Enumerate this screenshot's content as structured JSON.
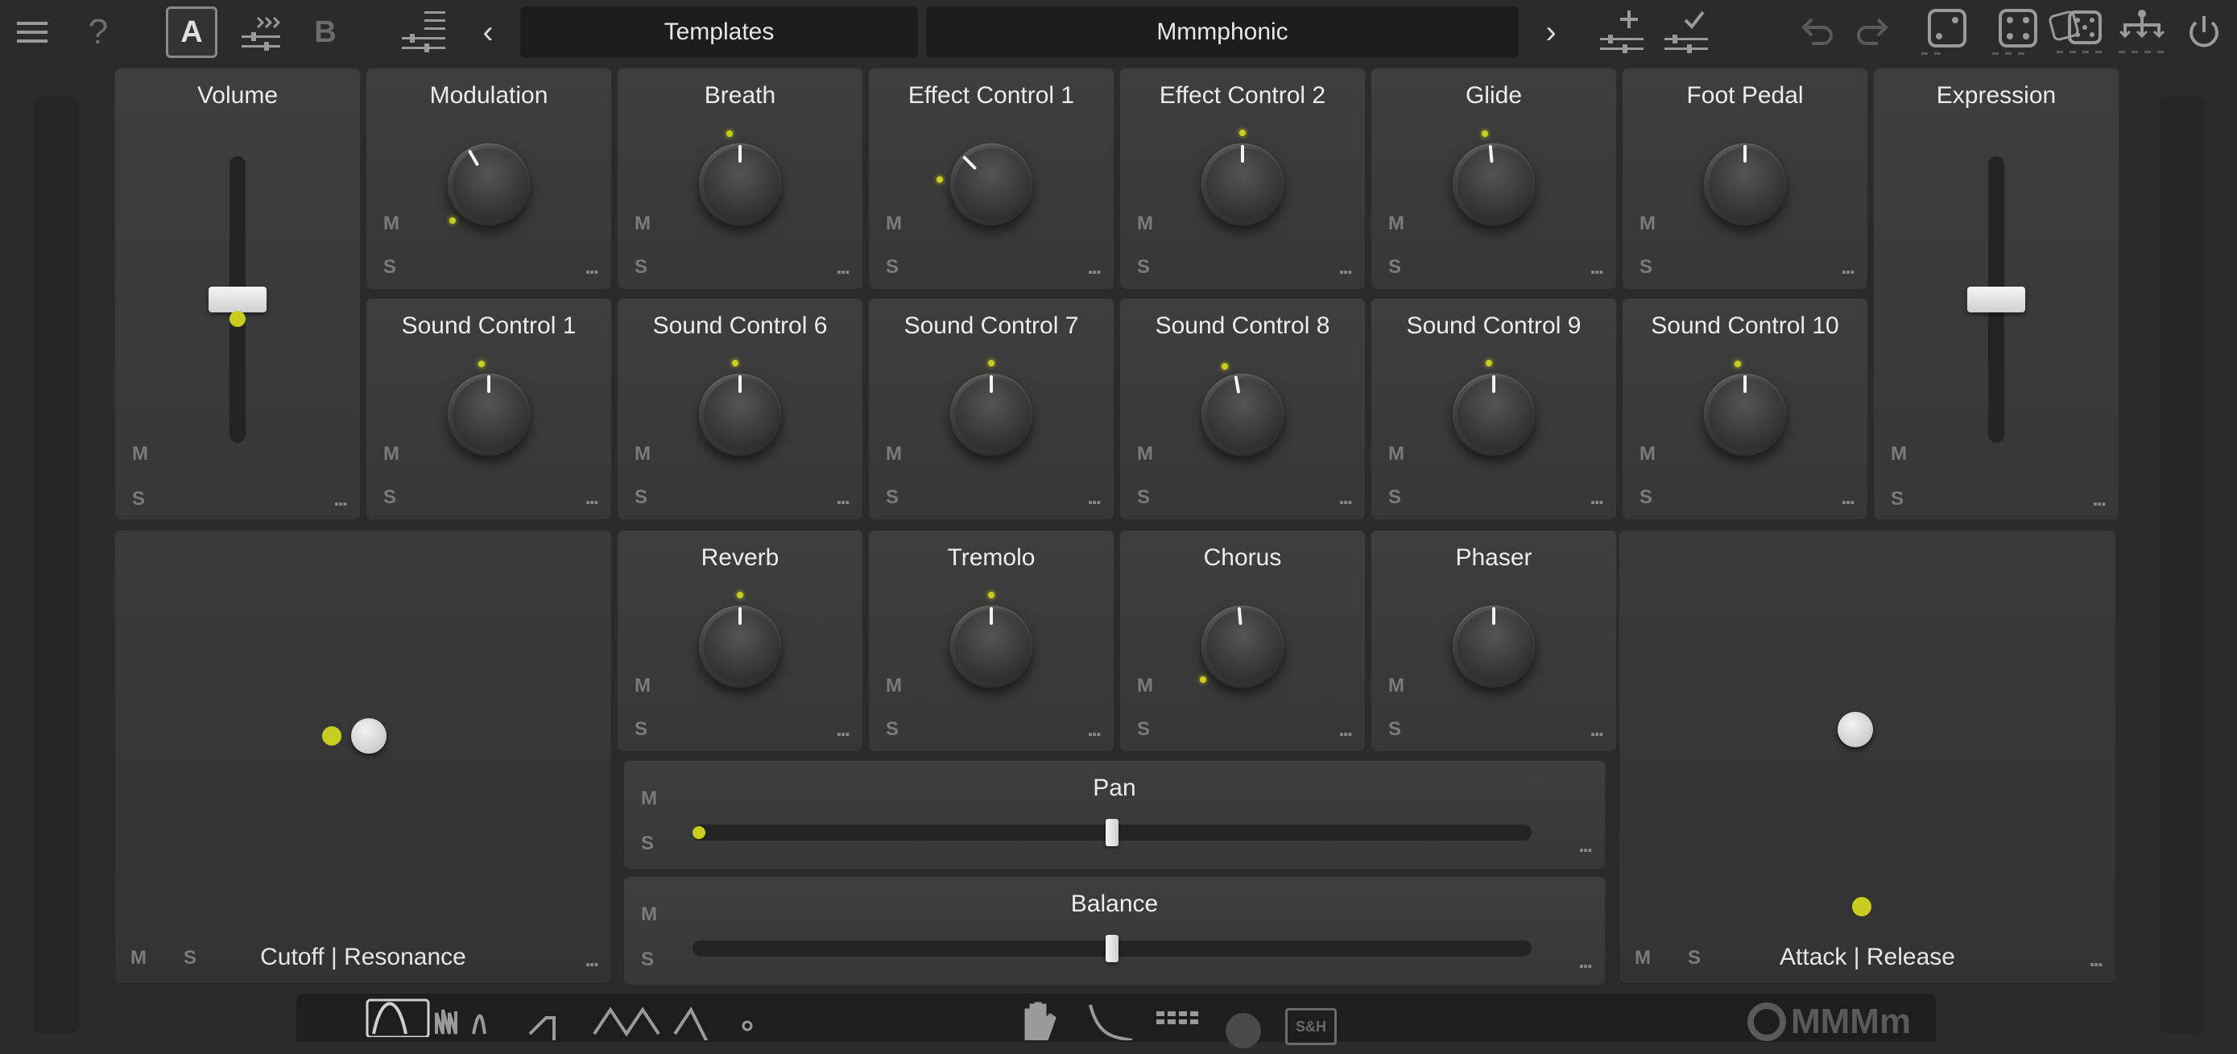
{
  "toolbar": {
    "a_label": "A",
    "b_label": "B",
    "prev": "‹",
    "next": "›",
    "preset_category": "Templates",
    "preset_name": "Mmmphonic",
    "icons": [
      "menu-icon",
      "help-icon",
      "copy-a-to-b-icon",
      "a-b-toggle-icon",
      "preset-list-icon",
      "prev-preset-icon",
      "next-preset-icon",
      "add-preset-icon",
      "save-preset-icon",
      "undo-icon",
      "redo-icon",
      "randomize-icon",
      "randomize-more-icon",
      "randomize-all-icon",
      "routing-icon",
      "power-icon"
    ]
  },
  "colors": {
    "accent": "#c9cd1f",
    "background": "#2b2b2b",
    "panel": "#3a3a3a"
  },
  "common": {
    "m": "M",
    "s": "S",
    "more": "..."
  },
  "controls": {
    "volume": {
      "title": "Volume",
      "value": 0.5
    },
    "expression": {
      "title": "Expression",
      "value": 0.5
    },
    "modulation": {
      "title": "Modulation"
    },
    "breath": {
      "title": "Breath"
    },
    "effect1": {
      "title": "Effect Control 1"
    },
    "effect2": {
      "title": "Effect Control 2"
    },
    "glide": {
      "title": "Glide"
    },
    "foot": {
      "title": "Foot Pedal"
    },
    "sc1": {
      "title": "Sound Control 1"
    },
    "sc6": {
      "title": "Sound Control 6"
    },
    "sc7": {
      "title": "Sound Control 7"
    },
    "sc8": {
      "title": "Sound Control 8"
    },
    "sc9": {
      "title": "Sound Control 9"
    },
    "sc10": {
      "title": "Sound Control 10"
    },
    "reverb": {
      "title": "Reverb"
    },
    "tremolo": {
      "title": "Tremolo"
    },
    "chorus": {
      "title": "Chorus"
    },
    "phaser": {
      "title": "Phaser"
    },
    "pan": {
      "title": "Pan",
      "value": 0.5
    },
    "balance": {
      "title": "Balance",
      "value": 0.5
    },
    "xy_left": {
      "title": "Cutoff | Resonance"
    },
    "xy_right": {
      "title": "Attack | Release"
    }
  },
  "bottom_bar": {
    "brand": "MMMm",
    "sh_label": "S&H"
  }
}
